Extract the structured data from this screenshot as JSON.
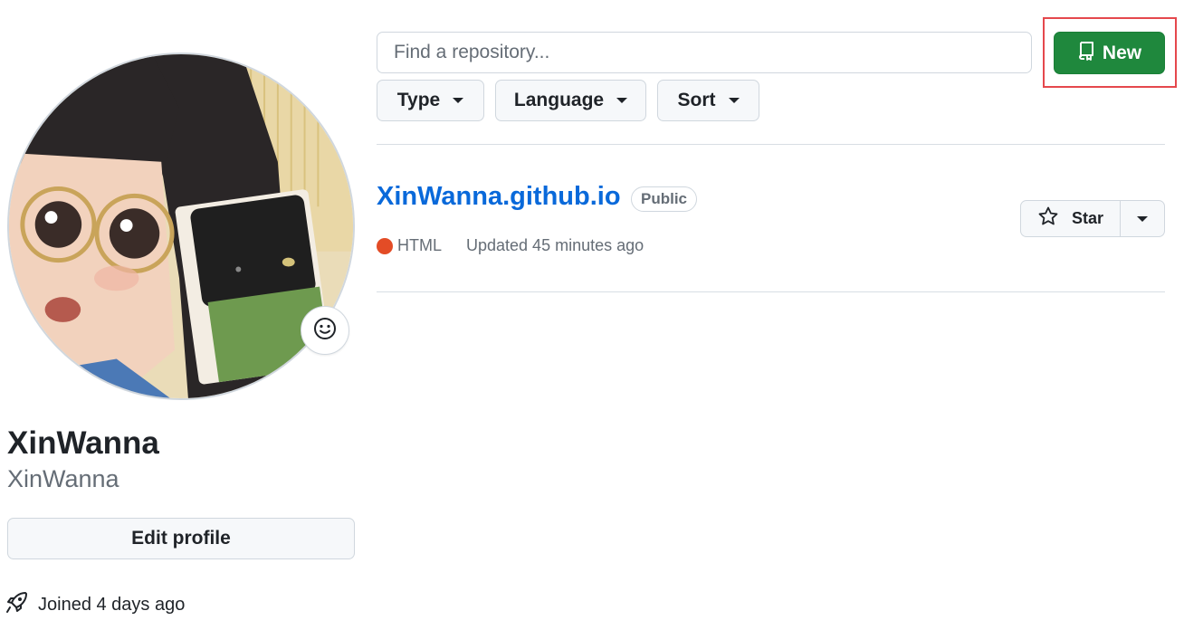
{
  "profile": {
    "full_name": "XinWanna",
    "username": "XinWanna",
    "edit_label": "Edit profile",
    "joined": "Joined 4 days ago"
  },
  "toolbar": {
    "search_placeholder": "Find a repository...",
    "new_label": "New",
    "filters": [
      {
        "label": "Type"
      },
      {
        "label": "Language"
      },
      {
        "label": "Sort"
      }
    ]
  },
  "repos": [
    {
      "name": "XinWanna.github.io",
      "visibility": "Public",
      "language": "HTML",
      "language_color": "#e34c26",
      "updated": "Updated 45 minutes ago",
      "star_label": "Star"
    }
  ],
  "colors": {
    "primary_green": "#1f883d",
    "link_blue": "#0969da",
    "highlight_red": "#e5484d"
  }
}
